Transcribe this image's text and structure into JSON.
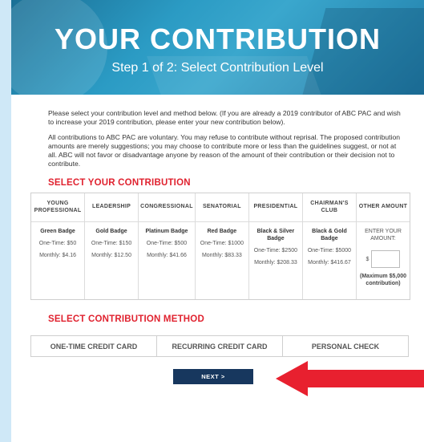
{
  "hero": {
    "title": "YOUR CONTRIBUTION",
    "subtitle": "Step 1 of 2: Select Contribution Level"
  },
  "intro": {
    "p1": "Please select your contribution level and method below. (If you are already a 2019 contributor of ABC PAC and wish to increase your 2019 contribution, please enter your new contribution below).",
    "p2": "All contributions to ABC PAC are voluntary. You may refuse to contribute without reprisal. The proposed contribution amounts are merely suggestions; you may choose to contribute more or less than the guidelines suggest, or not at all. ABC will not favor or disadvantage anyone by reason of the amount of their contribution or their decision not to contribute."
  },
  "select_contribution_title": "SELECT YOUR CONTRIBUTION",
  "levels": [
    {
      "header": "YOUNG PROFESSIONAL",
      "badge": "Green Badge",
      "onetime": "One-Time: $50",
      "monthly": "Monthly: $4.16"
    },
    {
      "header": "LEADERSHIP",
      "badge": "Gold Badge",
      "onetime": "One-Time: $150",
      "monthly": "Monthly: $12.50"
    },
    {
      "header": "CONGRESSIONAL",
      "badge": "Platinum Badge",
      "onetime": "One-Time: $500",
      "monthly": "Monthly: $41.66"
    },
    {
      "header": "SENATORIAL",
      "badge": "Red Badge",
      "onetime": "One-Time: $1000",
      "monthly": "Monthly: $83.33"
    },
    {
      "header": "PRESIDENTIAL",
      "badge": "Black & Silver Badge",
      "onetime": "One-Time: $2500",
      "monthly": "Monthly: $208.33"
    },
    {
      "header": "CHAIRMAN'S CLUB",
      "badge": "Black & Gold Badge",
      "onetime": "One-Time: $5000",
      "monthly": "Monthly: $416.67"
    }
  ],
  "other": {
    "header": "OTHER AMOUNT",
    "prompt": "ENTER YOUR AMOUNT:",
    "currency": "$",
    "input_value": "",
    "max_note": "(Maximum $5,000 contribution)"
  },
  "select_method_title": "SELECT CONTRIBUTION METHOD",
  "methods": [
    "ONE-TIME CREDIT CARD",
    "RECURRING CREDIT CARD",
    "PERSONAL CHECK"
  ],
  "next_label": "NEXT >",
  "colors": {
    "accent_red": "#e0222f",
    "navy": "#17375e",
    "arrow": "#e8202f"
  }
}
